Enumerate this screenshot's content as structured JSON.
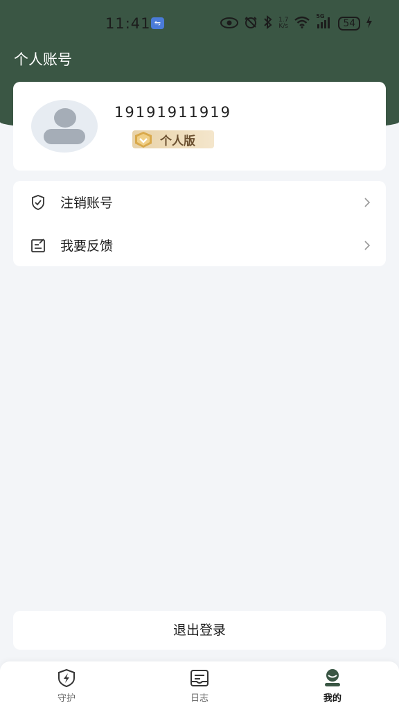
{
  "status_bar": {
    "time": "11:41",
    "network_speed": "1.7\nK/s",
    "signal_type": "5G",
    "battery": "54"
  },
  "header": {
    "title": "个人账号"
  },
  "profile": {
    "phone": "19191911919",
    "badge_label": "个人版"
  },
  "menu": {
    "items": [
      {
        "label": "注销账号",
        "icon": "shield-check-icon"
      },
      {
        "label": "我要反馈",
        "icon": "feedback-edit-icon"
      }
    ]
  },
  "logout": {
    "label": "退出登录"
  },
  "bottom_nav": {
    "items": [
      {
        "label": "守护",
        "icon": "shield-bolt-icon",
        "active": false
      },
      {
        "label": "日志",
        "icon": "log-icon",
        "active": false
      },
      {
        "label": "我的",
        "icon": "user-icon",
        "active": true
      }
    ]
  },
  "colors": {
    "header_bg": "#3a5644",
    "page_bg": "#f3f5f8",
    "badge_bg": "#e8d2a8",
    "badge_text": "#6b5030"
  }
}
